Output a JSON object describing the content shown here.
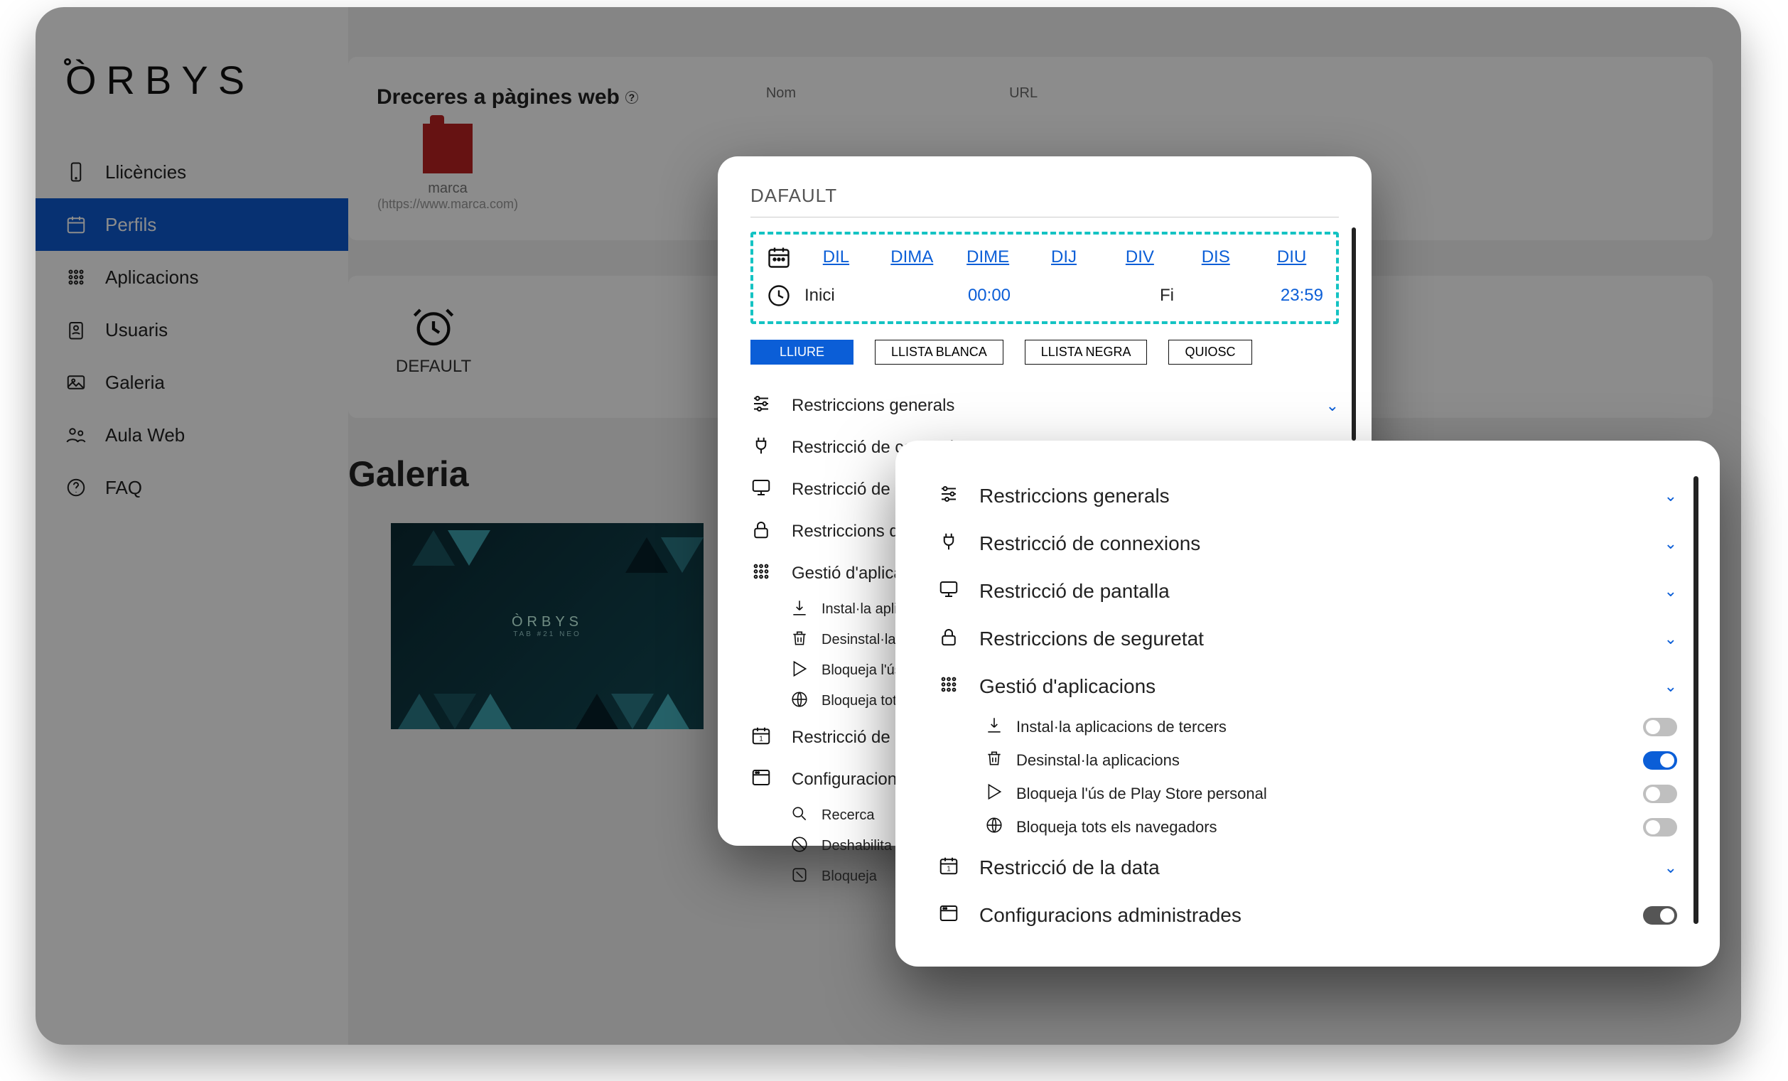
{
  "brand": "ÒRBYS",
  "sidebar": {
    "items": [
      {
        "label": "Llicències"
      },
      {
        "label": "Perfils"
      },
      {
        "label": "Aplicacions"
      },
      {
        "label": "Usuaris"
      },
      {
        "label": "Galeria"
      },
      {
        "label": "Aula Web"
      },
      {
        "label": "FAQ"
      }
    ]
  },
  "shortcuts": {
    "title": "Dreceres a pàgines web",
    "fields": {
      "name": "Nom",
      "url": "URL"
    },
    "tile": {
      "name": "marca",
      "url": "(https://www.marca.com)"
    }
  },
  "default_profile": {
    "label": "DEFAULT"
  },
  "gallery": {
    "heading": "Galeria",
    "stamp": "ÒRBYS",
    "stamp_sub": "TAB #21 NEO"
  },
  "modal1": {
    "title": "DAFAULT",
    "days": [
      "DIL",
      "DIMA",
      "DIME",
      "DIJ",
      "DIV",
      "DIS",
      "DIU"
    ],
    "start_label": "Inici",
    "start_value": "00:00",
    "end_label": "Fi",
    "end_value": "23:59",
    "modes": [
      "LLIURE",
      "LLISTA BLANCA",
      "LLISTA NEGRA",
      "QUIOSC"
    ],
    "sections": [
      "Restriccions generals",
      "Restricció de connexions",
      "Restricció de pantalla",
      "Restriccions de seguretat",
      "Gestió d'aplicacions",
      "Restricció de la data",
      "Configuracions administrades"
    ],
    "app_subs": [
      "Instal·la aplicacions de tercers",
      "Desinstal·la aplicacions",
      "Bloqueja l'ús de Play Store personal",
      "Bloqueja tots els navegadors"
    ],
    "config_subs": [
      "Recerca",
      "Deshabilita",
      "Bloqueja"
    ]
  },
  "modal2": {
    "sections": [
      {
        "label": "Restriccions generals"
      },
      {
        "label": "Restricció de connexions"
      },
      {
        "label": "Restricció de pantalla"
      },
      {
        "label": "Restriccions de seguretat"
      },
      {
        "label": "Gestió d'aplicacions"
      },
      {
        "label": "Restricció de la data"
      },
      {
        "label": "Configuracions administrades"
      }
    ],
    "app_subs": [
      {
        "label": "Instal·la aplicacions de tercers",
        "on": false
      },
      {
        "label": "Desinstal·la aplicacions",
        "on": true
      },
      {
        "label": "Bloqueja l'ús de Play Store personal",
        "on": false
      },
      {
        "label": "Bloqueja tots els navegadors",
        "on": false
      }
    ]
  }
}
